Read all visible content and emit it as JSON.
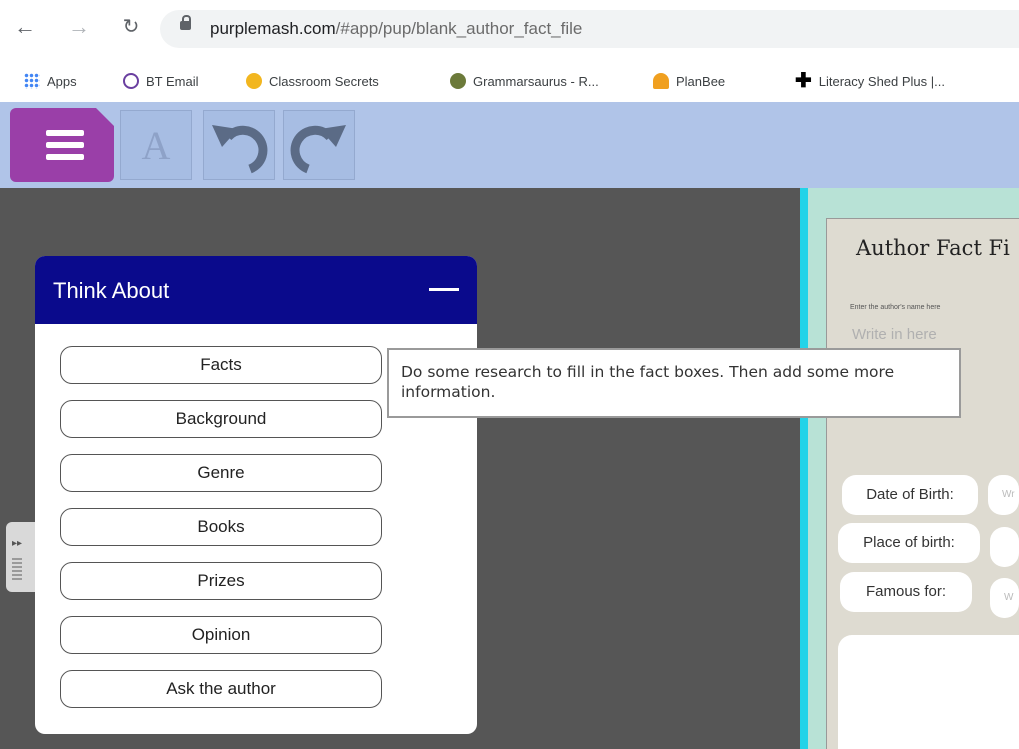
{
  "browser": {
    "url_host": "purplemash.com",
    "url_path": "/#app/pup/blank_author_fact_file",
    "bookmarks": [
      {
        "label": "Apps",
        "color": "#e8a33d"
      },
      {
        "label": "BT Email",
        "color": "#6a3fa0"
      },
      {
        "label": "Classroom Secrets",
        "color": "#f2b61f"
      },
      {
        "label": "Grammarsaurus - R...",
        "color": "#6c7a3a"
      },
      {
        "label": "PlanBee",
        "color": "#f0a020"
      },
      {
        "label": "Literacy Shed Plus |...",
        "color": "#000000"
      }
    ]
  },
  "toolbar": {
    "font_label": "A"
  },
  "panel": {
    "title": "Think About",
    "topics": [
      "Facts",
      "Background",
      "Genre",
      "Books",
      "Prizes",
      "Opinion",
      "Ask the author"
    ]
  },
  "tooltip": {
    "text": "Do some research to fill in the fact boxes. Then add some more information."
  },
  "sheet": {
    "title": "Author Fact Fi",
    "hint": "Enter the author's name here",
    "write_placeholder": "Write in here",
    "fields": [
      {
        "label": "Date of Birth:",
        "value": "Wr"
      },
      {
        "label": "Place of birth:",
        "value": ""
      },
      {
        "label": "Famous for:",
        "value": "W"
      }
    ]
  },
  "colors": {
    "toolbar_bg": "#b0c4e8",
    "menu_purple": "#9a3fa8",
    "panel_header": "#0a0a8c",
    "workspace": "#565656",
    "doc_accent": "#23d3e8"
  }
}
